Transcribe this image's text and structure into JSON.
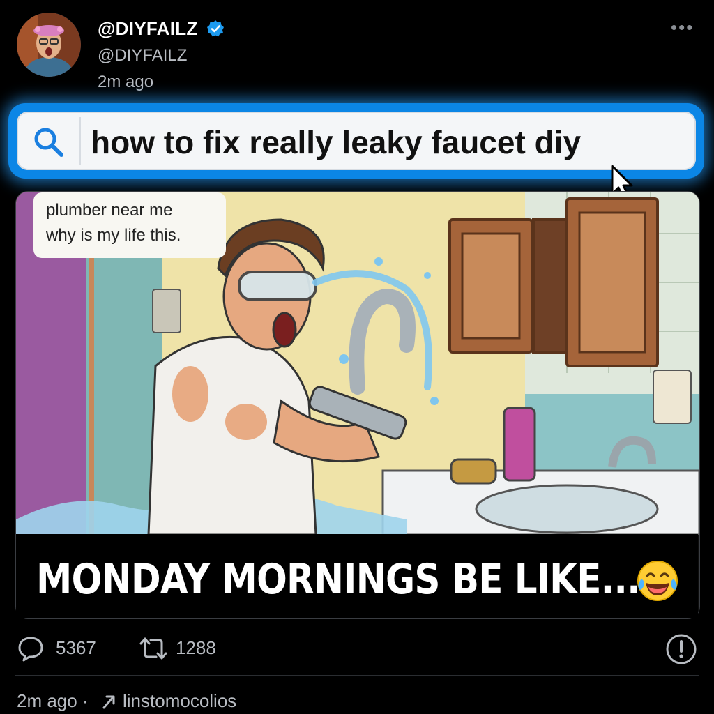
{
  "post": {
    "display_name": "@DIYFAILZ",
    "handle": "@DIYFAILZ",
    "time": "2m ago",
    "verified": true,
    "more_icon": "more-horizontal-icon"
  },
  "search": {
    "icon": "search-icon",
    "query": "how to fix really leaky faucet diy"
  },
  "media": {
    "suggestions": [
      "plumber near me",
      "why is my life this."
    ],
    "caption": "MONDAY MORNINGS BE LIKE...",
    "caption_emoji": "tears-of-joy-emoji"
  },
  "actions": {
    "replies": "5367",
    "retweets": "1288",
    "info_icon": "info-icon"
  },
  "footer": {
    "time": "2m ago",
    "separator": "·",
    "user": "linstomocolios"
  },
  "colors": {
    "background": "#000000",
    "glow": "#0b86e6",
    "verified": "#1d9bf0",
    "search_icon": "#1a7fe0",
    "muted_text": "#b8bcc2"
  }
}
